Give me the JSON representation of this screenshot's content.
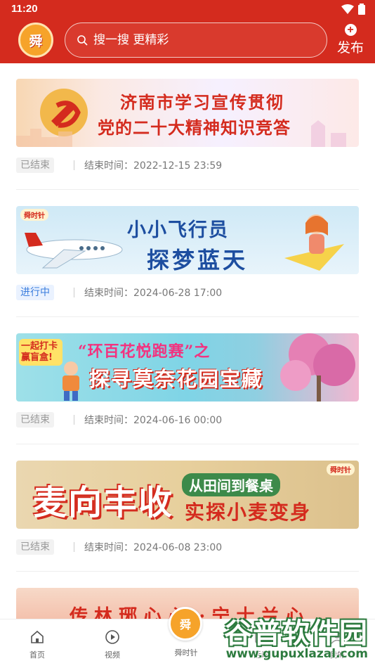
{
  "status_bar": {
    "time": "11:20"
  },
  "header": {
    "logo_text": "舜",
    "search_placeholder": "搜一搜 更精彩",
    "publish_label": "发布"
  },
  "colors": {
    "brand_red": "#d42b1e",
    "ongoing_blue": "#3b7ddd",
    "ended_gray": "#999999"
  },
  "activities": [
    {
      "banner_line1": "济南市学习宣传贯彻",
      "banner_line2": "党的二十大精神知识竞答",
      "status": "已结束",
      "end_time": "结束时间：2022-12-15 23:59"
    },
    {
      "banner_logo": "舜时针",
      "banner_line1": "小小飞行员",
      "banner_line2": "探梦蓝天",
      "status": "进行中",
      "end_time": "结束时间：2024-06-28 17:00"
    },
    {
      "banner_tag": "一起打卡 赢盲盒!",
      "banner_line1": "“环百花悦跑赛”之",
      "banner_line2": "探寻莫奈花园宝藏",
      "status": "已结束",
      "end_time": "结束时间：2024-06-16 00:00"
    },
    {
      "banner_line1": "麦向丰收",
      "banner_line2": "从田间到餐桌",
      "banner_line3": "实探小麦变身",
      "banner_logo": "舜时针",
      "status": "已结束",
      "end_time": "结束时间：2024-06-08 23:00"
    },
    {
      "banner_line1": "传 林 琊 心 心 ·· 宁 士 兰 心"
    }
  ],
  "bottom_nav": {
    "items": [
      {
        "label": "首页",
        "icon": "home-icon"
      },
      {
        "label": "视频",
        "icon": "video-icon"
      },
      {
        "label": "舜时针",
        "icon": "app-logo-icon"
      },
      {
        "label": "活动",
        "icon": "activity-icon"
      },
      {
        "label": "我的",
        "icon": "profile-icon"
      }
    ],
    "center_logo_text": "舜"
  },
  "watermark": {
    "title": "谷普软件园",
    "url": "www.gupuxlazal.com"
  }
}
